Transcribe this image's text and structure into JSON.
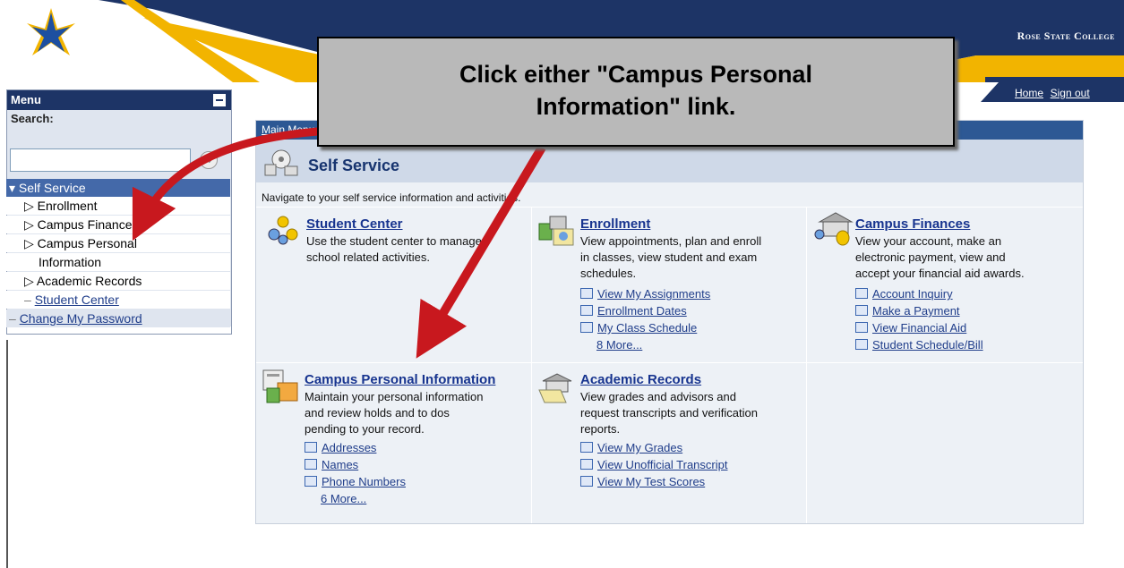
{
  "header": {
    "college_name": "Rose State College",
    "home_link": "Home",
    "signout_link": "Sign out"
  },
  "menu": {
    "title": "Menu",
    "search_label": "Search:",
    "search_value": "",
    "items": [
      {
        "label": "▾ Self Service",
        "selected": true
      },
      {
        "label": "▷ Enrollment"
      },
      {
        "label": "▷ Campus Finances"
      },
      {
        "label": "▷ Campus Personal"
      },
      {
        "label": "Information"
      },
      {
        "label": "▷ Academic Records"
      },
      {
        "label": "Student Center"
      },
      {
        "label": "Change My Password"
      }
    ]
  },
  "content": {
    "breadcrumb": "Main Menu",
    "section_title": "Self Service",
    "description": "Navigate to your self service information and activities.",
    "cells": {
      "student_center": {
        "title": "Student Center",
        "desc": [
          "Use the student center to manage",
          "school related activities."
        ]
      },
      "enrollment": {
        "title": "Enrollment",
        "desc": [
          "View appointments, plan and enroll",
          "in classes, view student and exam",
          "schedules."
        ],
        "links": [
          "View My Assignments",
          "Enrollment Dates",
          "My Class Schedule"
        ],
        "more": "8 More..."
      },
      "campus_finances": {
        "title": "Campus Finances",
        "desc": [
          "View your account, make an",
          "electronic payment, view and",
          "accept your financial aid awards."
        ],
        "links": [
          "Account Inquiry",
          "Make a Payment",
          "View Financial Aid",
          "Student Schedule/Bill"
        ]
      },
      "campus_personal": {
        "title": "Campus Personal Information",
        "desc": [
          "Maintain your personal information",
          "and review holds and to dos",
          "pending to your record."
        ],
        "links": [
          "Addresses",
          "Names",
          "Phone Numbers"
        ],
        "more": "6 More..."
      },
      "academic_records": {
        "title": "Academic Records",
        "desc": [
          "View grades and advisors and",
          "request transcripts and verification",
          "reports."
        ],
        "links": [
          "View My Grades",
          "View Unofficial Transcript",
          "View My Test Scores"
        ]
      }
    }
  },
  "callout": {
    "line1": "Click either \"Campus Personal",
    "line2": "Information\" link."
  },
  "colors": {
    "header_navy": "#1d3466",
    "header_gold": "#f2b400",
    "arrow_red": "#c8181e"
  }
}
